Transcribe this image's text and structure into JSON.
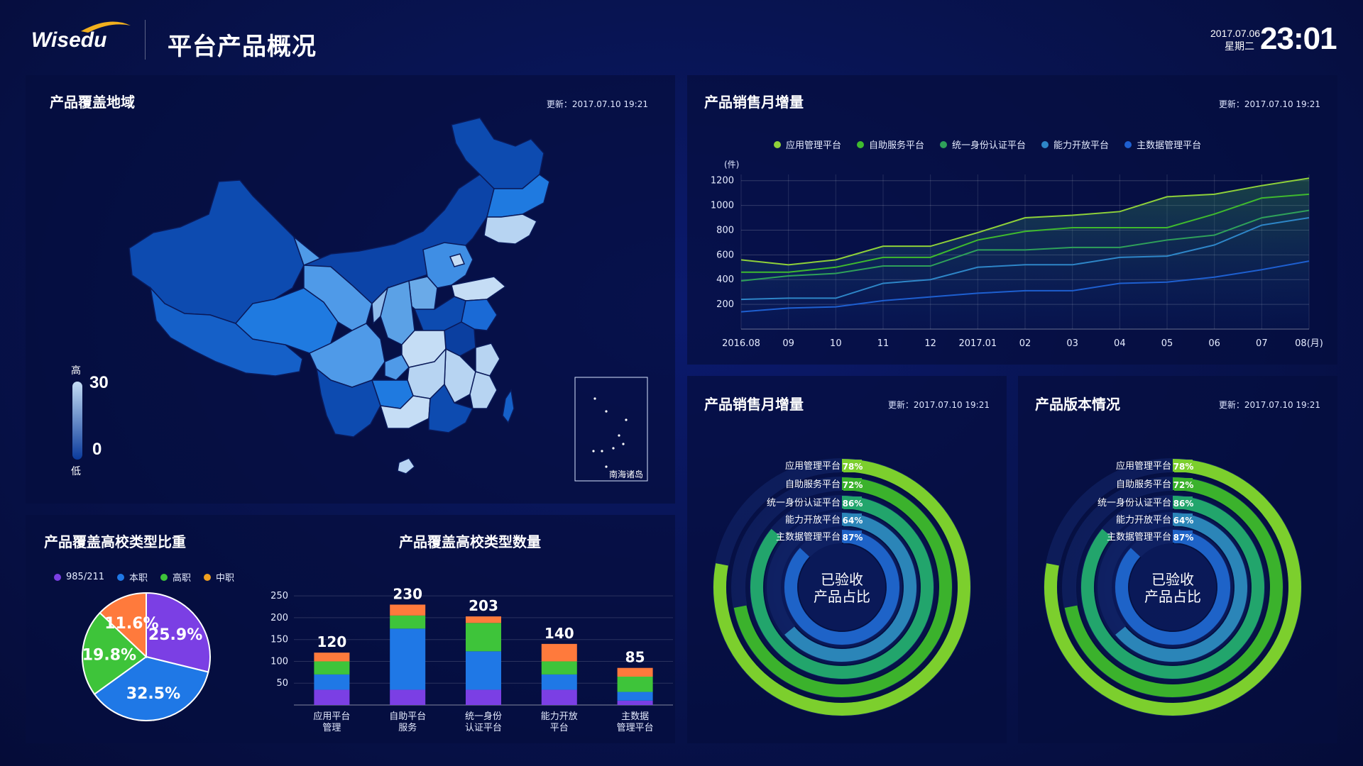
{
  "header": {
    "logo_text": "Wisedu",
    "title": "平台产品概况",
    "date": "2017.07.06",
    "weekday": "星期二",
    "time": "23:01"
  },
  "map_panel": {
    "title": "产品覆盖地域",
    "update": "更新：2017.07.10 19:21",
    "scale_high_label": "高",
    "scale_low_label": "低",
    "scale_max": "30",
    "scale_min": "0",
    "inset_label": "南海诸岛"
  },
  "line_panel": {
    "title": "产品销售月增量",
    "update": "更新：2017.07.10 19:21"
  },
  "ring1_panel": {
    "title": "产品销售月增量",
    "update": "更新：2017.07.10 19:21",
    "center_line1": "已验收",
    "center_line2": "产品占比"
  },
  "ring2_panel": {
    "title": "产品版本情况",
    "update": "更新：2017.07.10 19:21",
    "center_line1": "已验收",
    "center_line2": "产品占比"
  },
  "pie_panel": {
    "title": "产品覆盖高校类型比重"
  },
  "bar_panel": {
    "title": "产品覆盖高校类型数量"
  },
  "colors": {
    "purple": "#7b3fe4",
    "blue": "#1f78e6",
    "green": "#3ec43a",
    "orange": "#ff7a3c",
    "gold": "#f0a020",
    "line1": "#8fd13a",
    "line2": "#3fba2e",
    "line3": "#2fa05a",
    "line4": "#2e86c8",
    "line5": "#1e5fd0"
  },
  "chart_data": [
    {
      "type": "line",
      "id": "monthly-sales",
      "ylabel": "(件)",
      "x": [
        "2016.08",
        "09",
        "10",
        "11",
        "12",
        "2017.01",
        "02",
        "03",
        "04",
        "05",
        "06",
        "07",
        "08(月)"
      ],
      "ylim": [
        0,
        1250
      ],
      "yticks": [
        200,
        400,
        600,
        800,
        1000,
        1200
      ],
      "grid": true,
      "legend_position": "top-center",
      "series": [
        {
          "name": "应用管理平台",
          "color": "#8fd13a",
          "values": [
            560,
            520,
            560,
            670,
            670,
            780,
            900,
            920,
            950,
            1070,
            1090,
            1160,
            1220
          ]
        },
        {
          "name": "自助服务平台",
          "color": "#3fba2e",
          "values": [
            460,
            460,
            500,
            580,
            580,
            720,
            790,
            820,
            820,
            820,
            930,
            1060,
            1090
          ]
        },
        {
          "name": "统一身份认证平台",
          "color": "#2fa05a",
          "values": [
            390,
            430,
            450,
            510,
            510,
            640,
            640,
            660,
            660,
            720,
            760,
            900,
            960
          ]
        },
        {
          "name": "能力开放平台",
          "color": "#2e86c8",
          "values": [
            240,
            250,
            250,
            370,
            400,
            500,
            520,
            520,
            580,
            590,
            680,
            840,
            900
          ]
        },
        {
          "name": "主数据管理平台",
          "color": "#1e5fd0",
          "values": [
            140,
            170,
            180,
            230,
            260,
            290,
            310,
            310,
            370,
            380,
            420,
            480,
            550
          ]
        }
      ]
    },
    {
      "type": "pie",
      "id": "school-type-share",
      "legend_position": "top-left",
      "labels": [
        "985/211",
        "本职",
        "高职",
        "中职"
      ],
      "slices": [
        {
          "label": "985/211",
          "value": 25.9,
          "text": "25.9%",
          "color": "#7b3fe4"
        },
        {
          "label": "本职",
          "value": 32.5,
          "text": "32.5%",
          "color": "#1f78e6"
        },
        {
          "label": "高职",
          "value": 19.8,
          "text": "19.8%",
          "color": "#3ec43a"
        },
        {
          "label": "中职",
          "value": 11.6,
          "text": "11.6%",
          "color": "#ff7a3c"
        }
      ]
    },
    {
      "type": "bar",
      "id": "school-type-count",
      "stacked": true,
      "categories": [
        "应用平台\n管理",
        "自助平台\n服务",
        "统一身份\n认证平台",
        "能力开放\n平台",
        "主数据\n管理平台"
      ],
      "totals": [
        120,
        230,
        203,
        140,
        85
      ],
      "ylim": [
        0,
        260
      ],
      "yticks": [
        50,
        100,
        150,
        200,
        250
      ],
      "series": [
        {
          "name": "985/211",
          "color": "#7b3fe4",
          "values": [
            35,
            35,
            35,
            35,
            10
          ]
        },
        {
          "name": "本职",
          "color": "#1f78e6",
          "values": [
            35,
            140,
            88,
            35,
            20
          ]
        },
        {
          "name": "高职",
          "color": "#3ec43a",
          "values": [
            30,
            30,
            65,
            30,
            35
          ]
        },
        {
          "name": "中职",
          "color": "#ff7a3c",
          "values": [
            20,
            25,
            15,
            40,
            20
          ]
        }
      ]
    },
    {
      "type": "radial-bar",
      "id": "accepted-ratio-1",
      "items": [
        {
          "name": "应用管理平台",
          "value": 78,
          "text": "78%",
          "color": "#7ccf2d"
        },
        {
          "name": "自助服务平台",
          "value": 72,
          "text": "72%",
          "color": "#3bb22c"
        },
        {
          "name": "统一身份认证平台",
          "value": 86,
          "text": "86%",
          "color": "#22a56c"
        },
        {
          "name": "能力开放平台",
          "value": 64,
          "text": "64%",
          "color": "#2b85b8"
        },
        {
          "name": "主数据管理平台",
          "value": 87,
          "text": "87%",
          "color": "#1e63c8"
        }
      ]
    },
    {
      "type": "radial-bar",
      "id": "accepted-ratio-2",
      "items": [
        {
          "name": "应用管理平台",
          "value": 78,
          "text": "78%",
          "color": "#7ccf2d"
        },
        {
          "name": "自助服务平台",
          "value": 72,
          "text": "72%",
          "color": "#3bb22c"
        },
        {
          "name": "统一身份认证平台",
          "value": 86,
          "text": "86%",
          "color": "#22a56c"
        },
        {
          "name": "能力开放平台",
          "value": 64,
          "text": "64%",
          "color": "#2b85b8"
        },
        {
          "name": "主数据管理平台",
          "value": 87,
          "text": "87%",
          "color": "#1e63c8"
        }
      ]
    }
  ]
}
